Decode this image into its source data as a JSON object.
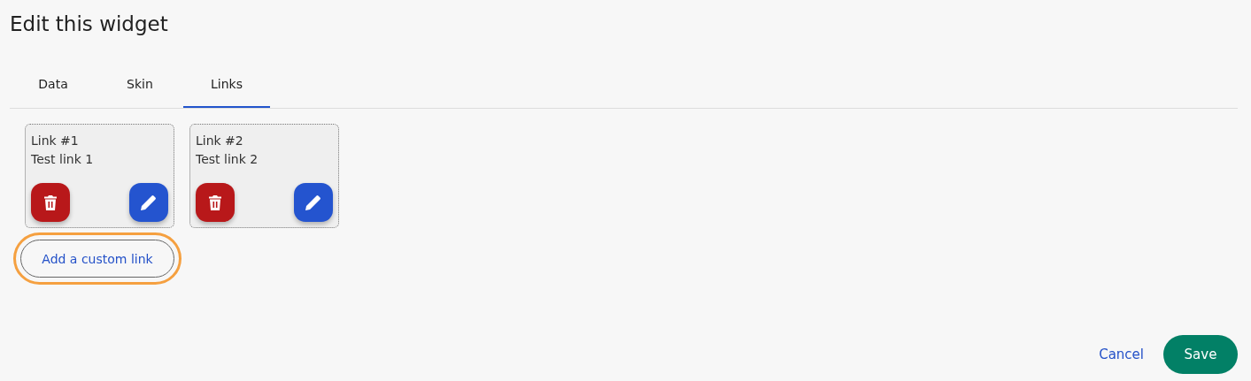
{
  "title": "Edit this widget",
  "tabs": [
    {
      "label": "Data",
      "selected": false
    },
    {
      "label": "Skin",
      "selected": false
    },
    {
      "label": "Links",
      "selected": true
    }
  ],
  "links": [
    {
      "name": "Link #1",
      "description": "Test link 1"
    },
    {
      "name": "Link #2",
      "description": "Test link 2"
    }
  ],
  "add_button": {
    "label": "Add a custom link",
    "focused": true
  },
  "footer": {
    "cancel": "Cancel",
    "save": "Save"
  }
}
